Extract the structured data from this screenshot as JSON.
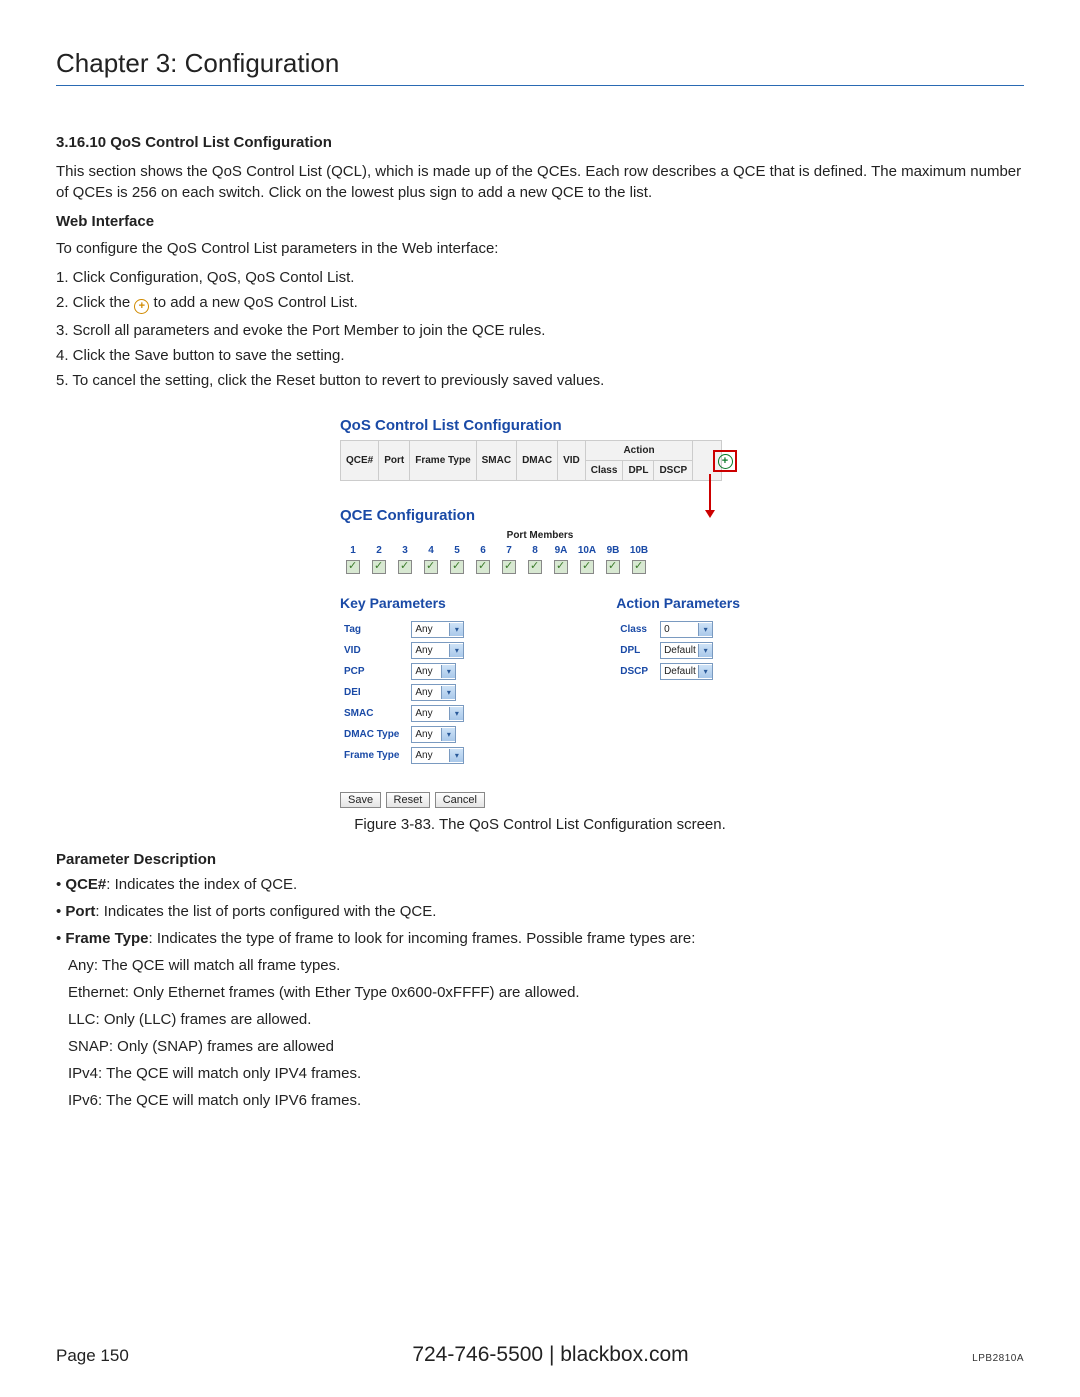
{
  "chapter_title": "Chapter 3: Configuration",
  "section_heading": "3.16.10 QoS Control List Configuration",
  "intro_para": "This section shows the QoS Control List (QCL), which is made up of the QCEs. Each row describes a QCE that is defined. The maximum number of QCEs is 256 on each switch. Click on the lowest plus sign to add a new QCE to the list.",
  "web_interface_heading": "Web Interface",
  "web_interface_intro": "To configure the QoS Control List parameters in the Web interface:",
  "steps": {
    "s1": "1. Click Configuration, QoS, QoS Contol List.",
    "s2a": "2. Click the ",
    "s2b": " to add a new QoS Control List.",
    "s3": "3. Scroll all parameters and evoke the Port Member to join the QCE rules.",
    "s4": "4. Click the Save button to save the setting.",
    "s5": "5. To cancel the setting, click the Reset button to revert to previously saved values."
  },
  "fig": {
    "qcl_title": "QoS Control List Configuration",
    "headers": {
      "qce": "QCE#",
      "port": "Port",
      "frame_type": "Frame Type",
      "smac": "SMAC",
      "dmac": "DMAC",
      "vid": "VID",
      "action": "Action",
      "class": "Class",
      "dpl": "DPL",
      "dscp": "DSCP"
    },
    "qce_title": "QCE Configuration",
    "port_members_label": "Port Members",
    "ports": [
      "1",
      "2",
      "3",
      "4",
      "5",
      "6",
      "7",
      "8",
      "9A",
      "10A",
      "9B",
      "10B"
    ],
    "key_params_title": "Key Parameters",
    "action_params_title": "Action Parameters",
    "key_params": {
      "tag": {
        "label": "Tag",
        "value": "Any"
      },
      "vid": {
        "label": "VID",
        "value": "Any"
      },
      "pcp": {
        "label": "PCP",
        "value": "Any"
      },
      "dei": {
        "label": "DEI",
        "value": "Any"
      },
      "smac": {
        "label": "SMAC",
        "value": "Any"
      },
      "dmac_type": {
        "label": "DMAC Type",
        "value": "Any"
      },
      "frame_type": {
        "label": "Frame Type",
        "value": "Any"
      }
    },
    "action_params": {
      "class": {
        "label": "Class",
        "value": "0"
      },
      "dpl": {
        "label": "DPL",
        "value": "Default"
      },
      "dscp": {
        "label": "DSCP",
        "value": "Default"
      }
    },
    "buttons": {
      "save": "Save",
      "reset": "Reset",
      "cancel": "Cancel"
    }
  },
  "figure_caption": "Figure 3-83. The QoS Control List Configuration screen.",
  "param_desc_heading": "Parameter Description",
  "param_desc": {
    "qce_label": "QCE#",
    "qce_text": ": Indicates the index of QCE.",
    "port_label": "Port",
    "port_text": ": Indicates the list of ports configured with the QCE.",
    "ft_label": "Frame Type",
    "ft_text": ": Indicates the type of frame to look for incoming frames. Possible frame types are:",
    "ft_any": "Any: The QCE will match all frame types.",
    "ft_eth": "Ethernet: Only Ethernet frames (with Ether Type 0x600-0xFFFF) are allowed.",
    "ft_llc": "LLC: Only (LLC) frames are allowed.",
    "ft_snap": "SNAP: Only (SNAP) frames are allowed",
    "ft_ipv4": "IPv4: The QCE will match only IPV4 frames.",
    "ft_ipv6": "IPv6: The QCE will match only IPV6 frames."
  },
  "footer": {
    "page": "Page 150",
    "center": "724-746-5500   |   blackbox.com",
    "model": "LPB2810A"
  }
}
